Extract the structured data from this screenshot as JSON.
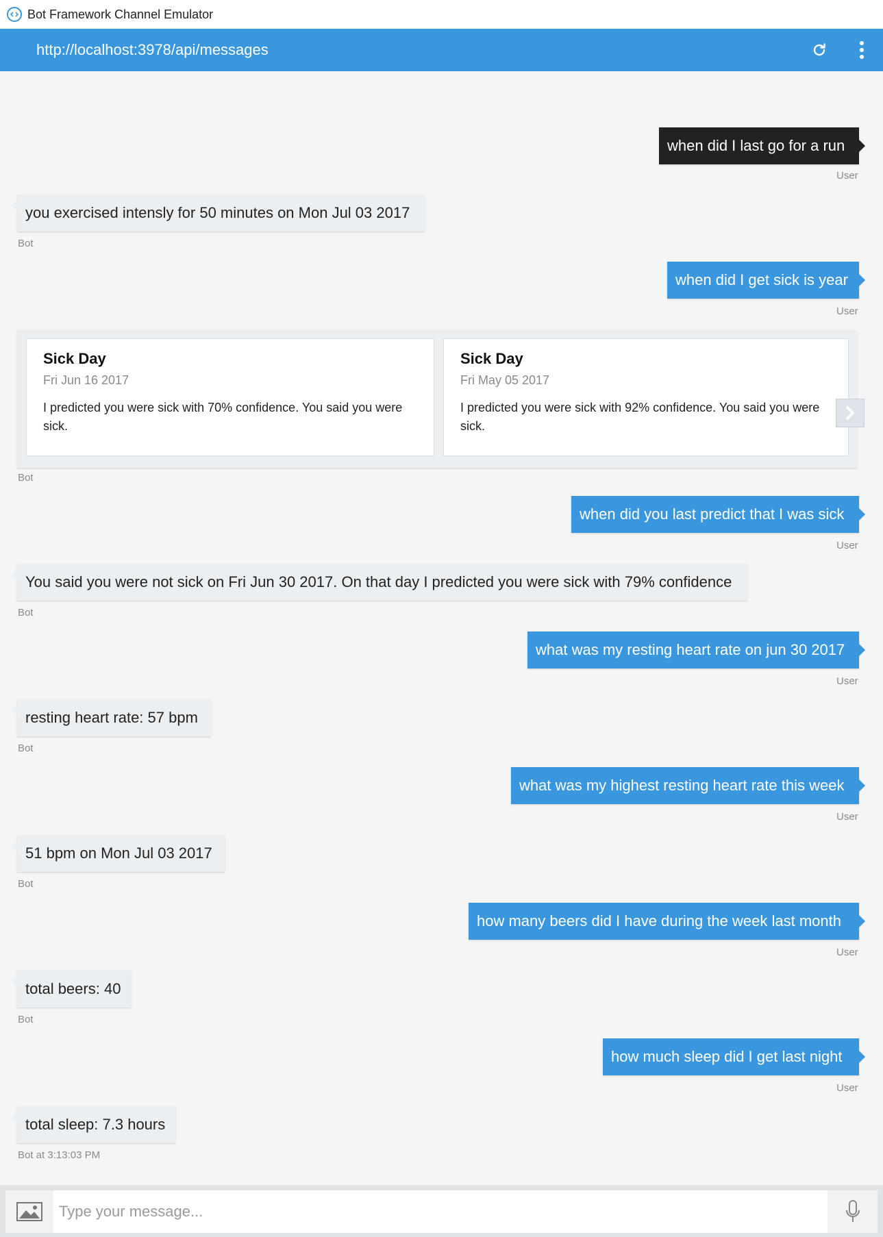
{
  "window": {
    "title": "Bot Framework Channel Emulator"
  },
  "header": {
    "endpoint": "http://localhost:3978/api/messages",
    "refresh_icon": "refresh-icon",
    "menu_icon": "more-vertical-icon"
  },
  "messages": [
    {
      "from": "user",
      "text": "when did I last go for a run",
      "meta": "User"
    },
    {
      "from": "bot",
      "text": "you exercised intensly for 50 minutes on Mon Jul 03 2017",
      "meta": "Bot"
    },
    {
      "from": "user",
      "text": "when did I get sick is year",
      "meta": "User"
    },
    {
      "from": "bot",
      "type": "carousel",
      "meta": "Bot",
      "cards": [
        {
          "title": "Sick Day",
          "subtitle": "Fri Jun 16 2017",
          "text": "I predicted you were sick with 70% confidence. You said you were sick."
        },
        {
          "title": "Sick Day",
          "subtitle": "Fri May 05 2017",
          "text": "I predicted you were sick with 92% confidence. You said you were sick."
        }
      ]
    },
    {
      "from": "user",
      "text": "when did you last predict that I was sick",
      "meta": "User"
    },
    {
      "from": "bot",
      "text": "You said you were not sick on Fri Jun 30 2017. On that day I predicted you were sick with 79% confidence",
      "meta": "Bot"
    },
    {
      "from": "user",
      "text": "what was my resting heart rate on jun 30 2017",
      "meta": "User"
    },
    {
      "from": "bot",
      "text": "resting heart rate: 57 bpm",
      "meta": "Bot"
    },
    {
      "from": "user",
      "text": "what was my highest resting heart rate this week",
      "meta": "User"
    },
    {
      "from": "bot",
      "text": "51 bpm on Mon Jul 03 2017",
      "meta": "Bot"
    },
    {
      "from": "user",
      "text": "how many beers did I have during the week last month",
      "meta": "User"
    },
    {
      "from": "bot",
      "text": "total beers: 40",
      "meta": "Bot"
    },
    {
      "from": "user",
      "text": "how much sleep did I get last night",
      "meta": "User"
    },
    {
      "from": "bot",
      "text": "total sleep: 7.3 hours",
      "meta": "Bot at 3:13:03 PM"
    }
  ],
  "composer": {
    "placeholder": "Type your message...",
    "image_icon": "image-icon",
    "mic_icon": "microphone-icon"
  },
  "colors": {
    "accent": "#3a96dd",
    "selected_message": "#222222",
    "bot_bubble": "#eceff1",
    "background": "#f5f5f5"
  }
}
